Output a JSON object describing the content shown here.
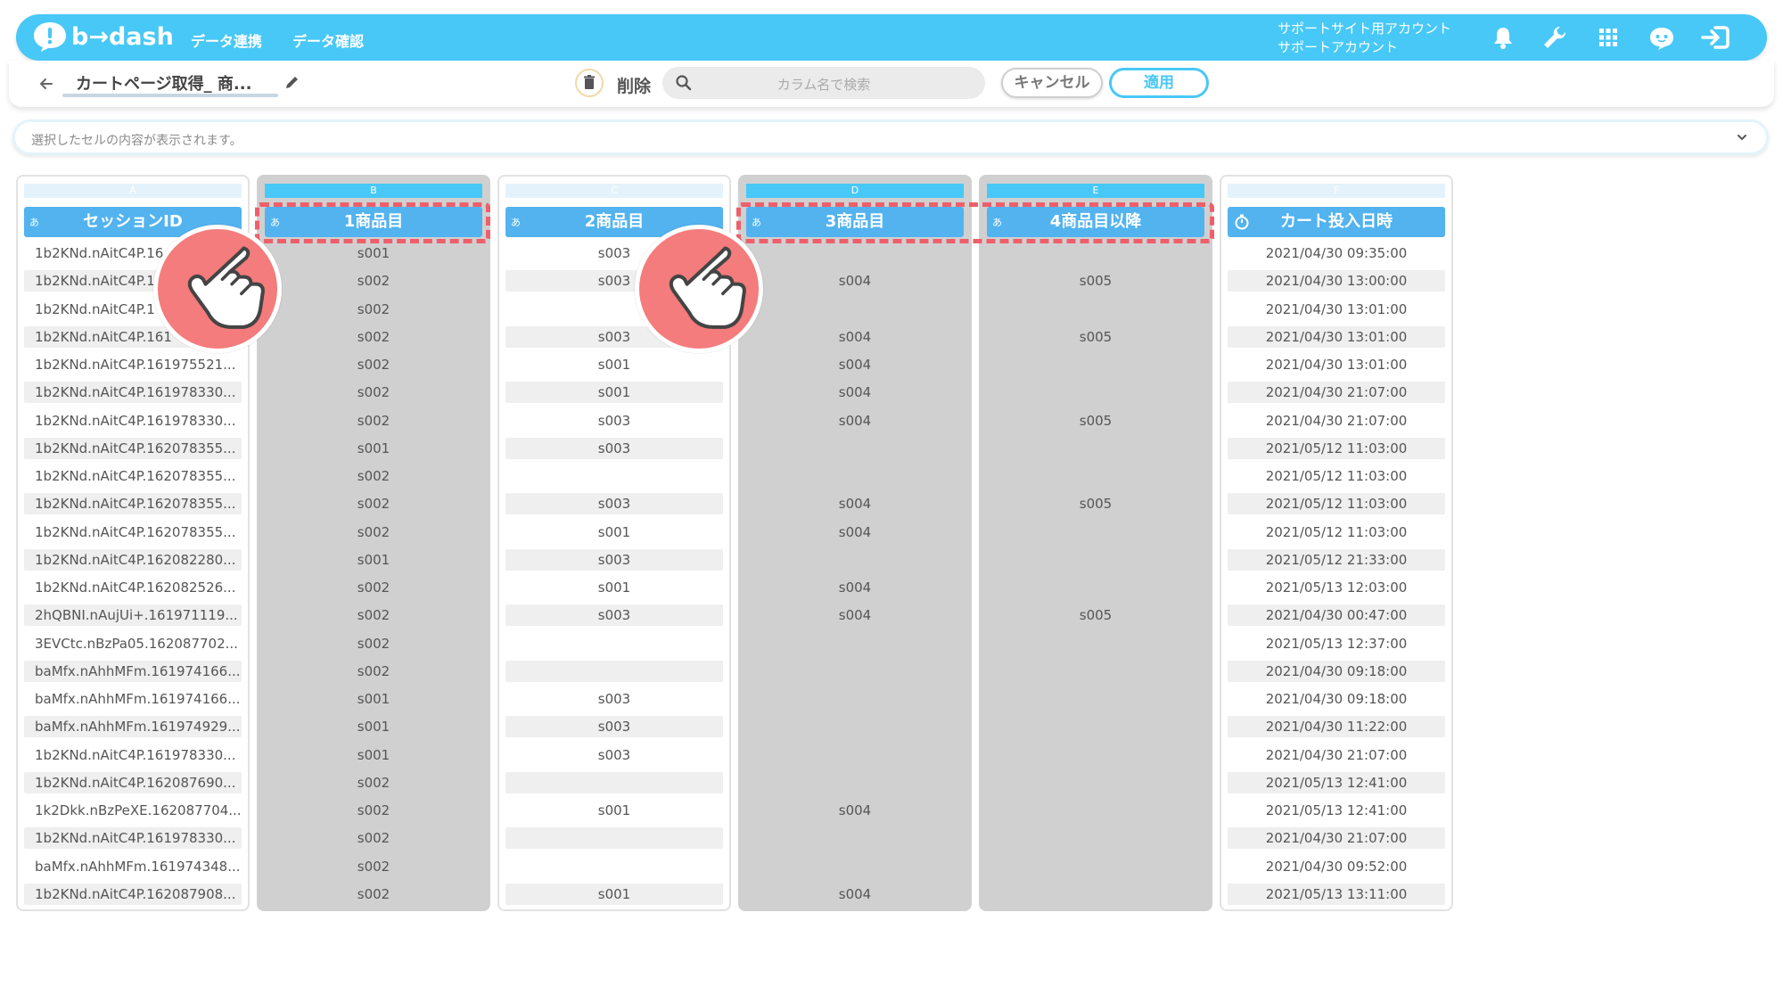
{
  "header": {
    "logo_text": "b→dash",
    "nav": [
      "データ連携",
      "データ確認"
    ],
    "account_line1": "サポートサイト用アカウント",
    "account_line2": "サポートアカウント",
    "brand_color": "#48c8f6"
  },
  "toolbar": {
    "back_icon": "arrow-left-icon",
    "title": "カートページ取得_ 商...",
    "delete_label": "削除",
    "search_placeholder": "カラム名で検索",
    "cancel_label": "キャンセル",
    "apply_label": "適用"
  },
  "cell_bar": {
    "placeholder": "選択したセルの内容が表示されます。"
  },
  "columns": [
    {
      "letter": "A",
      "type": "あ",
      "header": "セッションID",
      "selected": false,
      "values": [
        "1b2KNd.nAitC4P.16",
        "1b2KNd.nAitC4P.1",
        "1b2KNd.nAitC4P.1",
        "1b2KNd.nAitC4P.161",
        "1b2KNd.nAitC4P.161975521...",
        "1b2KNd.nAitC4P.161978330...",
        "1b2KNd.nAitC4P.161978330...",
        "1b2KNd.nAitC4P.162078355...",
        "1b2KNd.nAitC4P.162078355...",
        "1b2KNd.nAitC4P.162078355...",
        "1b2KNd.nAitC4P.162078355...",
        "1b2KNd.nAitC4P.162082280...",
        "1b2KNd.nAitC4P.162082526...",
        "2hQBNI.nAujUi+.161971119...",
        "3EVCtc.nBzPa05.162087702...",
        "baMfx.nAhhMFm.161974166...",
        "baMfx.nAhhMFm.161974166...",
        "baMfx.nAhhMFm.161974929...",
        "1b2KNd.nAitC4P.161978330...",
        "1b2KNd.nAitC4P.162087690...",
        "1k2Dkk.nBzPeXE.162087704...",
        "1b2KNd.nAitC4P.161978330...",
        "baMfx.nAhhMFm.161974348...",
        "1b2KNd.nAitC4P.162087908..."
      ]
    },
    {
      "letter": "B",
      "type": "あ",
      "header": "1商品目",
      "selected": true,
      "values": [
        "s001",
        "s002",
        "s002",
        "s002",
        "s002",
        "s002",
        "s002",
        "s001",
        "s002",
        "s002",
        "s002",
        "s001",
        "s002",
        "s002",
        "s002",
        "s002",
        "s001",
        "s001",
        "s001",
        "s002",
        "s002",
        "s002",
        "s002",
        "s002"
      ]
    },
    {
      "letter": "C",
      "type": "あ",
      "header": "2商品目",
      "selected": false,
      "values": [
        "s003",
        "s003",
        "",
        "s003",
        "s001",
        "s001",
        "s003",
        "s003",
        "",
        "s003",
        "s001",
        "s003",
        "s001",
        "s003",
        "",
        "",
        "s003",
        "s003",
        "s003",
        "",
        "s001",
        "",
        "",
        "s001"
      ]
    },
    {
      "letter": "D",
      "type": "あ",
      "header": "3商品目",
      "selected": true,
      "values": [
        "",
        "s004",
        "",
        "s004",
        "s004",
        "s004",
        "s004",
        "",
        "",
        "s004",
        "s004",
        "",
        "s004",
        "s004",
        "",
        "",
        "",
        "",
        "",
        "",
        "s004",
        "",
        "",
        "s004"
      ]
    },
    {
      "letter": "E",
      "type": "あ",
      "header": "4商品目以降",
      "selected": true,
      "values": [
        "",
        "s005",
        "",
        "s005",
        "",
        "",
        "s005",
        "",
        "",
        "s005",
        "",
        "",
        "",
        "s005",
        "",
        "",
        "",
        "",
        "",
        "",
        "",
        "",
        "",
        ""
      ]
    },
    {
      "letter": "F",
      "type": "clock",
      "header": "カート投入日時",
      "selected": false,
      "values": [
        "2021/04/30 09:35:00",
        "2021/04/30 13:00:00",
        "2021/04/30 13:01:00",
        "2021/04/30 13:01:00",
        "2021/04/30 13:01:00",
        "2021/04/30 21:07:00",
        "2021/04/30 21:07:00",
        "2021/05/12 11:03:00",
        "2021/05/12 11:03:00",
        "2021/05/12 11:03:00",
        "2021/05/12 11:03:00",
        "2021/05/12 21:33:00",
        "2021/05/13 12:03:00",
        "2021/04/30 00:47:00",
        "2021/05/13 12:37:00",
        "2021/04/30 09:18:00",
        "2021/04/30 09:18:00",
        "2021/04/30 11:22:00",
        "2021/04/30 21:07:00",
        "2021/05/13 12:41:00",
        "2021/05/13 12:41:00",
        "2021/04/30 21:07:00",
        "2021/04/30 09:52:00",
        "2021/05/13 13:11:00"
      ]
    }
  ],
  "highlight_color": "#ee5f6b",
  "hand_color": "#f47c7c"
}
